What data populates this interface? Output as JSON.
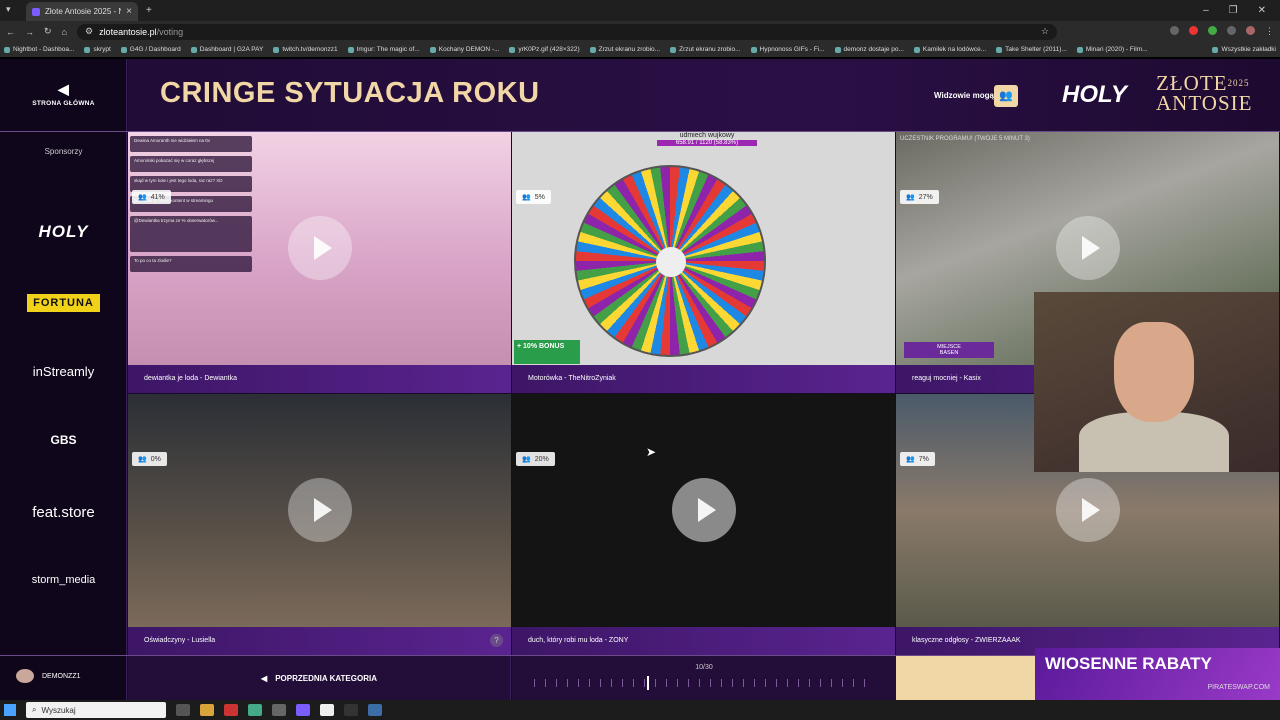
{
  "browser": {
    "tab_title": "Złote Antosie 2025 - Największ",
    "url_host": "zloteantosie.pl",
    "url_path": "/voting",
    "bookmarks": [
      "Nightbot - Dashboa...",
      "skrypt",
      "G4G / Dashboard",
      "Dashboard | G2A PAY",
      "twitch.tv/demonzz1",
      "Imgur: The magic of...",
      "Kochany DEMON -...",
      "yrK0Pz.gif (428×322)",
      "Zrzut ekranu zrobio...",
      "Zrzut ekranu zrobio...",
      "Hypnonoss GIFs - Fi...",
      "demonz dostaje po...",
      "Kamilek na lodówce...",
      "Take Shelter (2011)...",
      "Minari (2020) - Film..."
    ],
    "bookmarks_all": "Wszystkie zakładki"
  },
  "sidebar": {
    "home_label": "STRONA GŁÓWNA",
    "sponsors_label": "Sponsorzy",
    "sponsors": [
      "HOLY",
      "FORTUNA",
      "inStreamly",
      "GBS",
      "feat.store",
      "storm_media"
    ],
    "username": "DEMONZZ1"
  },
  "header": {
    "category_title": "CRINGE SYTUACJA ROKU",
    "viewers_label": "Widzowie mogą",
    "brand_holy": "HOLY",
    "brand_zlote": "ZŁOTE",
    "brand_antosie": "ANTOSIE",
    "brand_year": "2025"
  },
  "cards": [
    {
      "caption": "dewiantka je loda - Dewiantka",
      "percent": "41%"
    },
    {
      "caption": "Motorówka - TheNitroZyniak",
      "percent": "5%"
    },
    {
      "caption": "reaguj mocniej - Kasix",
      "percent": "27%"
    },
    {
      "caption": "Oświadczyny - Lusiella",
      "percent": "0%"
    },
    {
      "caption": "duch, który robi mu loda - ZONY",
      "percent": "20%"
    },
    {
      "caption": "klasyczne odgłosy - ZWIERZAAAK",
      "percent": "7%"
    }
  ],
  "overlays": {
    "wheel_title": "udmiech wujkowy",
    "wheel_value": "658.91 / 1120 (58.83%)",
    "bonus": "+ 10% BONUS",
    "contest_text": "UCZESTNIK PROGRAMU! (TWOJE 5 MINUT 3)",
    "miejsce": "MIEJSCE",
    "basen": "BASEN",
    "chat": [
      "Dewina Amoranth nie widziałem na ttv",
      "Amonimiki pokazać się w coraz głębszej",
      "skąd w tym kole i jest tego loda, raz raz? XD",
      "baseadłe to nowy kontent w streamingu",
      "@Dewiantka trzyma ze % obserwatorów...",
      "To po co ta zlodie?"
    ]
  },
  "bottom": {
    "prev_category": "POPRZEDNIA KATEGORIA",
    "progress_label": "10/30",
    "progress_current": 10,
    "progress_total": 30,
    "promo_title": "WIOSENNE RABATY",
    "promo_sub": "PIRATESWAP.COM"
  },
  "taskbar": {
    "search_placeholder": "Wyszukaj"
  },
  "colors": {
    "accent_gold": "#f2d7a6",
    "purple": "#2a0f45",
    "fortuna_yellow": "#f2d218"
  }
}
